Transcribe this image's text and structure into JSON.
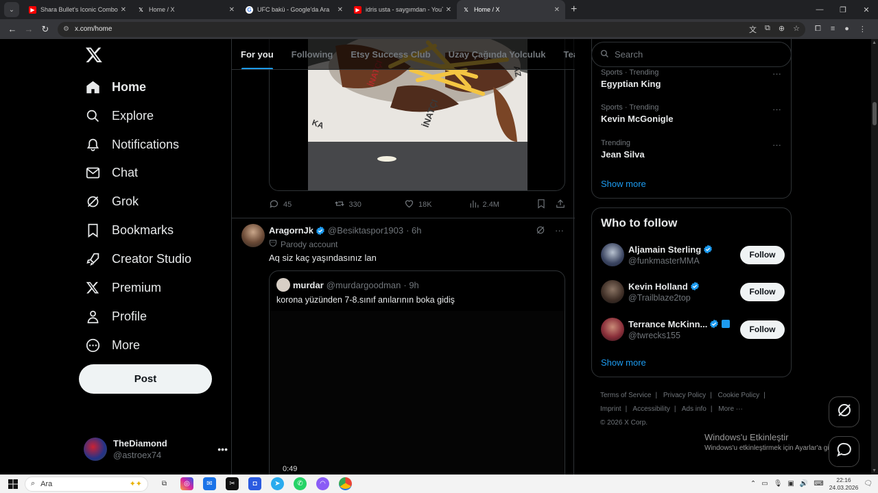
{
  "browser": {
    "tabs": [
      {
        "title": "Shara Bullet's Iconic Combo",
        "favicon": "youtube-icon",
        "active": false
      },
      {
        "title": "Home / X",
        "favicon": "x-icon",
        "active": false
      },
      {
        "title": "UFC bakü - Google'da Ara",
        "favicon": "google-icon",
        "active": false
      },
      {
        "title": "idris usta - saygımdan - YouTub",
        "favicon": "youtube-icon",
        "active": false
      },
      {
        "title": "Home / X",
        "favicon": "x-icon",
        "active": true
      }
    ],
    "url": "x.com/home"
  },
  "nav": {
    "items": [
      {
        "label": "Home",
        "icon": "home-icon"
      },
      {
        "label": "Explore",
        "icon": "search-icon"
      },
      {
        "label": "Notifications",
        "icon": "bell-icon"
      },
      {
        "label": "Chat",
        "icon": "mail-icon"
      },
      {
        "label": "Grok",
        "icon": "grok-icon"
      },
      {
        "label": "Bookmarks",
        "icon": "bookmark-icon"
      },
      {
        "label": "Creator Studio",
        "icon": "rocket-icon"
      },
      {
        "label": "Premium",
        "icon": "x-icon"
      },
      {
        "label": "Profile",
        "icon": "person-icon"
      },
      {
        "label": "More",
        "icon": "more-circle-icon"
      }
    ],
    "post_label": "Post",
    "account": {
      "name": "TheDiamond",
      "handle": "@astroex74"
    }
  },
  "feed": {
    "tabs": [
      "For you",
      "Following",
      "Etsy Success Club",
      "Uzay Çağında Yolculuk",
      "Team M"
    ],
    "active_tab": "For you",
    "tweet1": {
      "replies": "45",
      "reposts": "330",
      "likes": "18K",
      "views": "2.4M",
      "photo_text": [
        "İNATÇI",
        "İNATÇI",
        "KA",
        "AZ"
      ]
    },
    "tweet2": {
      "name": "AragornJk",
      "handle": "@Besiktaspor1903",
      "time": "· 6h",
      "label": "Parody account",
      "text": "Aq siz kaç yaşındasınız lan",
      "quote": {
        "name": "murdar",
        "handle": "@murdargoodman",
        "time": "· 9h",
        "text": "korona yüzünden 7-8.sınıf anılarının boka gidiş",
        "video_time": "0:49"
      }
    }
  },
  "sidebar": {
    "search_placeholder": "Search",
    "trends": [
      {
        "context": "Sports · Trending",
        "name": "Egyptian King"
      },
      {
        "context": "Sports · Trending",
        "name": "Kevin McGonigle"
      },
      {
        "context": "Trending",
        "name": "Jean Silva"
      }
    ],
    "trends_show_more": "Show more",
    "who_to_follow_title": "Who to follow",
    "follow": [
      {
        "name": "Aljamain Sterling",
        "handle": "@funkmasterMMA",
        "button": "Follow"
      },
      {
        "name": "Kevin Holland",
        "handle": "@Trailblaze2top",
        "button": "Follow"
      },
      {
        "name": "Terrance McKinn...",
        "handle": "@twrecks155",
        "button": "Follow"
      }
    ],
    "follow_show_more": "Show more",
    "footer": [
      "Terms of Service",
      "Privacy Policy",
      "Cookie Policy",
      "Imprint",
      "Accessibility",
      "Ads info",
      "More ···",
      "© 2026 X Corp."
    ]
  },
  "watermark": {
    "line1": "Windows'u Etkinleştir",
    "line2": "Windows'u etkinleştirmek için Ayarlar'a gidin."
  },
  "taskbar": {
    "search_placeholder": "Ara",
    "time": "22:16",
    "date": "24.03.2026"
  },
  "colors": {
    "accent": "#1d9bf0",
    "background": "#000000",
    "border": "#2f3336",
    "muted": "#71767b"
  }
}
